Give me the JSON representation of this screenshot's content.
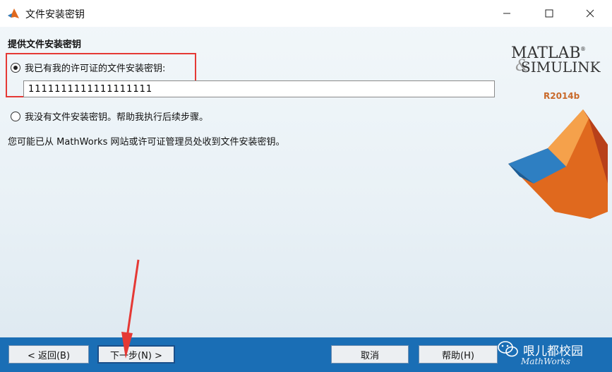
{
  "window": {
    "title": "文件安装密钥",
    "controls": {
      "minimize": "—",
      "maximize": "☐",
      "close": "✕"
    }
  },
  "form": {
    "heading": "提供文件安装密钥",
    "option_have_key": {
      "label": "我已有我的许可证的文件安装密钥:",
      "checked": true
    },
    "key_value": "1111111111111111111",
    "option_no_key": {
      "label": "我没有文件安装密钥。帮助我执行后续步骤。",
      "checked": false
    },
    "info_text": "您可能已从 MathWorks 网站或许可证管理员处收到文件安装密钥。"
  },
  "branding": {
    "logo_line1": "MATLAB",
    "logo_line2": "SIMULINK",
    "registered": "®",
    "ampersand": "&",
    "release": "R2014b",
    "footer_logo": "MathWorks"
  },
  "buttons": {
    "back": "< 返回(B)",
    "next": "下一步(N) >",
    "cancel": "取消",
    "help": "帮助(H)"
  },
  "watermark": {
    "name": "哏儿都校园"
  },
  "colors": {
    "accent_red": "#e53935",
    "bottom_bar": "#1a6eb5",
    "matlab_orange": "#e0691e",
    "matlab_blue": "#2e7fc2"
  }
}
